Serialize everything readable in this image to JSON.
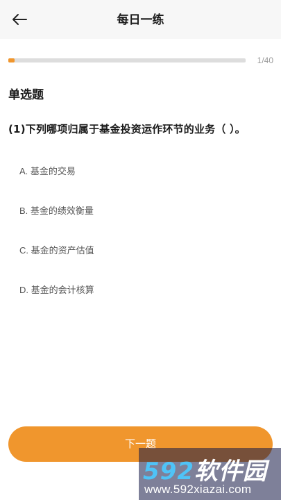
{
  "header": {
    "title": "每日一练",
    "back_icon": "arrow-left-icon"
  },
  "progress": {
    "text": "1/40",
    "current": 1,
    "total": 40,
    "fill_color": "#f0962d"
  },
  "question": {
    "type_label": "单选题",
    "text": "(1)下列哪项归属于基金投资运作环节的业务（   ）。",
    "options": [
      "A. 基金的交易",
      "B. 基金的绩效衡量",
      "C. 基金的资产估值",
      "D. 基金的会计核算"
    ]
  },
  "footer": {
    "next_label": "下一题"
  },
  "watermark": {
    "digits": "592",
    "cn": "软件园",
    "url": "www.592xiazai.com"
  },
  "colors": {
    "accent": "#f0962d",
    "header_bg": "#f7f7f7"
  }
}
